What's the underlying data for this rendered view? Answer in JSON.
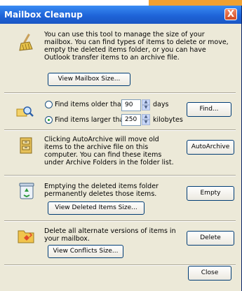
{
  "window": {
    "title": "Mailbox Cleanup",
    "close_glyph": "X"
  },
  "intro": {
    "icon": "broom-icon",
    "text": "You can use this tool to manage the size of your mailbox. You can find types of items to delete or move, empty the deleted items folder, or you can have Outlook transfer items to an archive file.",
    "button": "View Mailbox Size..."
  },
  "find": {
    "icon": "magnifier-icon",
    "older_label": "Find items older than",
    "older_value": "90",
    "older_unit": "days",
    "larger_label": "Find items larger than",
    "larger_value": "250",
    "larger_unit": "kilobytes",
    "selected": "larger",
    "button": "Find..."
  },
  "archive": {
    "icon": "archive-cabinet-icon",
    "text": "Clicking AutoArchive will move old items to the archive file on this computer. You can find these items under Archive Folders in the folder list.",
    "button": "AutoArchive"
  },
  "deleted": {
    "icon": "recycle-bin-icon",
    "text": "Emptying the deleted items folder permanently deletes those items.",
    "button": "Empty",
    "view_button": "View Deleted Items Size..."
  },
  "conflicts": {
    "icon": "conflict-folder-icon",
    "text": "Delete all alternate versions of items in your mailbox.",
    "button": "Delete",
    "view_button": "View Conflicts Size..."
  },
  "footer": {
    "close_button": "Close"
  }
}
